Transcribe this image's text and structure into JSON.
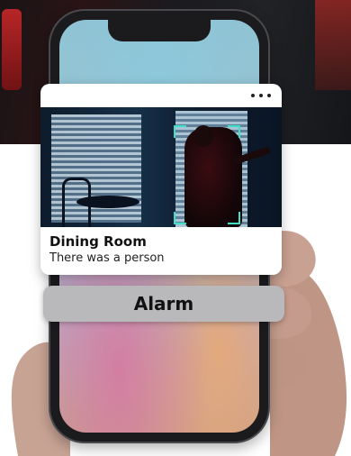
{
  "notification": {
    "room": "Dining Room",
    "message": "There was a person"
  },
  "actions": {
    "alarm_label": "Alarm"
  },
  "colors": {
    "detection_box": "#3ee0c8",
    "card_background": "#ffffff",
    "alarm_button": "#b9b9bb"
  },
  "icons": {
    "menu": "more-horizontal-icon"
  }
}
